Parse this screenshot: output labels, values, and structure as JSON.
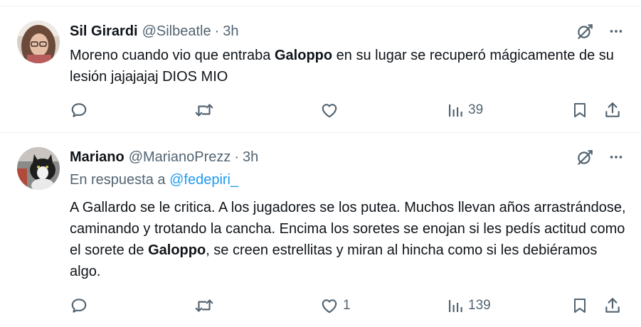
{
  "tweets": [
    {
      "author_name": "Sil Girardi",
      "handle": "@Silbeatle",
      "separator": "·",
      "time": "3h",
      "reply_prefix": "",
      "reply_handle": "",
      "text_before": "Moreno cuando vio que entraba ",
      "text_bold": "Galoppo",
      "text_after": " en su lugar se recuperó mágicamente de su lesión jajajajaj DIOS MIO",
      "text_after_2": "",
      "like_count": "",
      "view_count": "39"
    },
    {
      "author_name": "Mariano",
      "handle": "@MarianoPrezz",
      "separator": "·",
      "time": "3h",
      "reply_prefix": "En respuesta a ",
      "reply_handle": "@fedepiri_",
      "text_before": "A Gallardo se le critica. A los jugadores se los putea. Muchos llevan años arrastrándose, caminando y trotando la cancha. Encima los soretes se enojan si les pedís actitud como el sorete de ",
      "text_bold": "Galoppo",
      "text_after": ", se creen estrellitas y miran al hincha como si les debiéramos algo.",
      "like_count": "1",
      "view_count": "139"
    }
  ],
  "icons": [
    "grok-icon",
    "more-icon",
    "reply-icon",
    "retweet-icon",
    "like-icon",
    "views-icon",
    "bookmark-icon",
    "share-icon"
  ],
  "colors": {
    "text": "#0f1419",
    "secondary": "#536471",
    "link": "#1d9bf0",
    "border": "#eff3f4"
  }
}
